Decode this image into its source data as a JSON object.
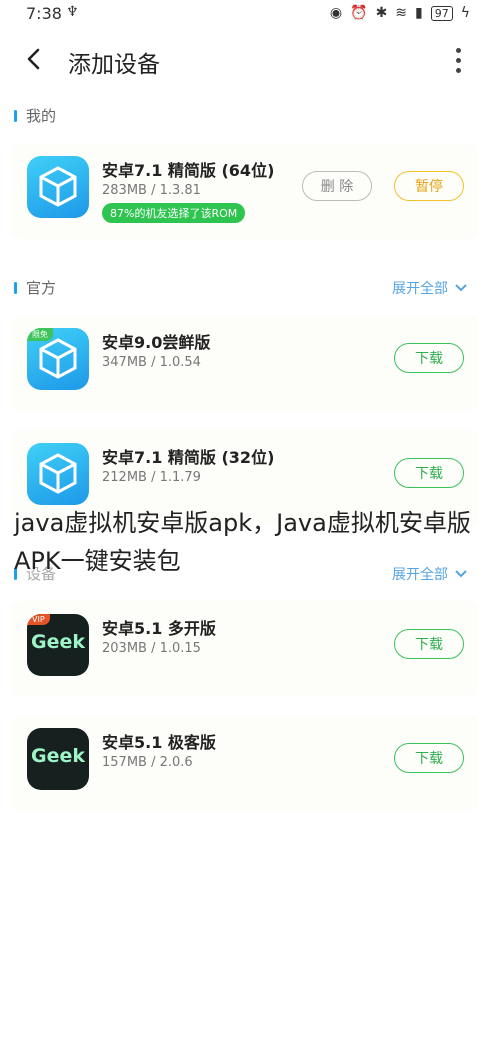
{
  "status_bar": {
    "time": "7:38",
    "battery": "97"
  },
  "header": {
    "title": "添加设备"
  },
  "sections": {
    "mine": {
      "label": "我的"
    },
    "official": {
      "label": "官方",
      "expand": "展开全部"
    },
    "device": {
      "label": "设备",
      "expand": "展开全部"
    }
  },
  "apps": [
    {
      "name": "安卓7.1 精简版 (64位)",
      "meta": "283MB / 1.3.81",
      "badge": "87%的机友选择了该ROM",
      "delete_label": "删 除",
      "pause_label": "暂停"
    },
    {
      "name": "安卓9.0尝鲜版",
      "meta": "347MB / 1.0.54",
      "tag": "限免",
      "action": "下载"
    },
    {
      "name": "安卓7.1 精简版 (32位)",
      "meta": "212MB / 1.1.79",
      "action": "下载"
    },
    {
      "name": "安卓5.1 多开版",
      "meta": "203MB / 1.0.15",
      "tag": "VIP",
      "icon_text": "Geek",
      "action": "下载"
    },
    {
      "name": "安卓5.1 极客版",
      "meta": "157MB / 2.0.6",
      "icon_text": "Geek",
      "action": "下载"
    }
  ],
  "watermark": "java虚拟机安卓版apk，Java虚拟机安卓版APK一键安装包",
  "colors": {
    "accent_blue": "#1aa3e8",
    "download_green": "#3bc25b",
    "pause_yellow": "#f1c12a"
  }
}
